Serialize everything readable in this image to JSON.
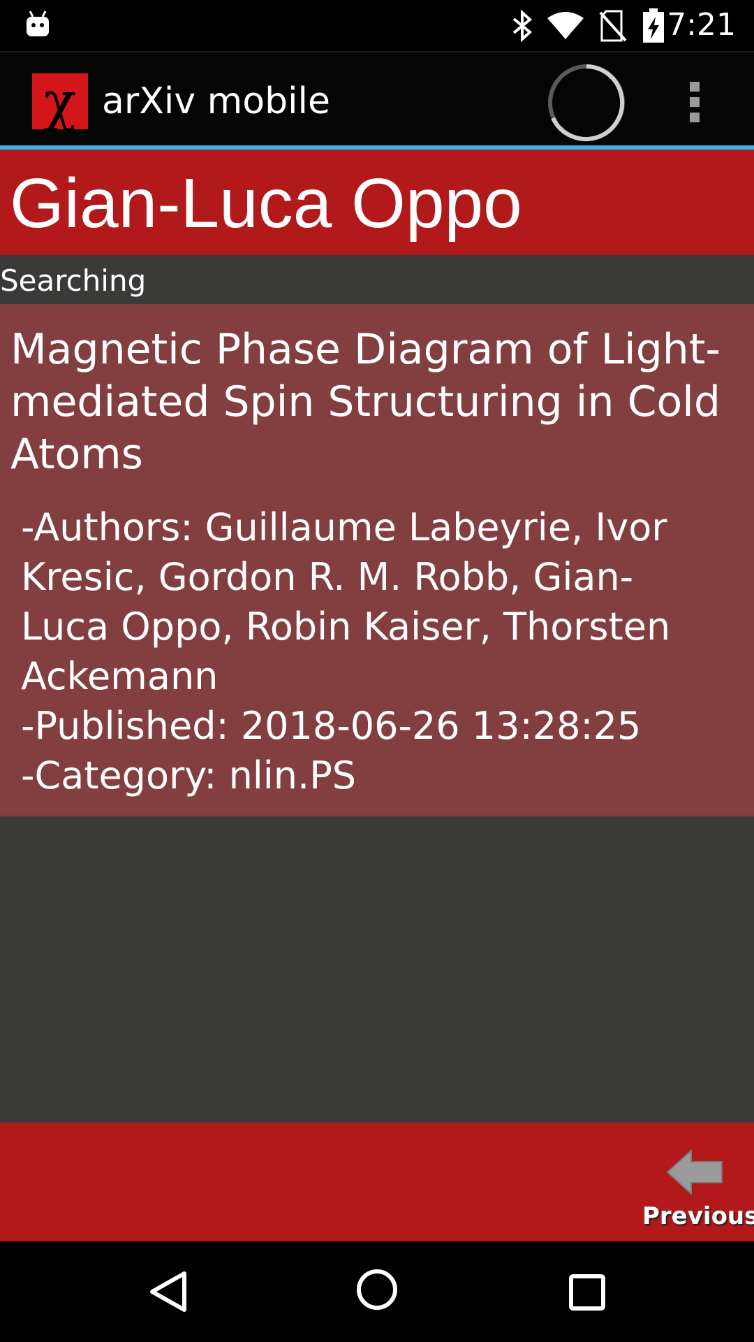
{
  "status_bar": {
    "time": "7:21",
    "icons": [
      "android-debug-icon",
      "bluetooth-icon",
      "wifi-icon",
      "no-sim-icon",
      "battery-charging-icon"
    ]
  },
  "action_bar": {
    "logo_glyph": "χ",
    "app_title": "arXiv mobile",
    "icons": [
      "loading-spinner-icon",
      "overflow-menu-icon"
    ]
  },
  "header": {
    "author_name": "Gian-Luca Oppo"
  },
  "status": {
    "searching_text": "Searching"
  },
  "results": [
    {
      "title": "Magnetic Phase Diagram of Light-mediated Spin Structuring in Cold Atoms",
      "authors": "-Authors: Guillaume Labeyrie, Ivor Kresic, Gordon R. M. Robb, Gian-Luca Oppo, Robin Kaiser, Thorsten Ackemann",
      "published": "-Published: 2018-06-26 13:28:25",
      "category": "-Category: nlin.PS"
    }
  ],
  "bottom_bar": {
    "previous_label": "Previous"
  },
  "nav_bar": {
    "icons": [
      "back-icon",
      "home-icon",
      "recents-icon"
    ]
  },
  "colors": {
    "header_red": "#b1191b",
    "card_bg": "#833e40",
    "list_bg": "#3a3a39",
    "accent_blue": "#33b5e5",
    "logo_red": "#d4151a"
  }
}
